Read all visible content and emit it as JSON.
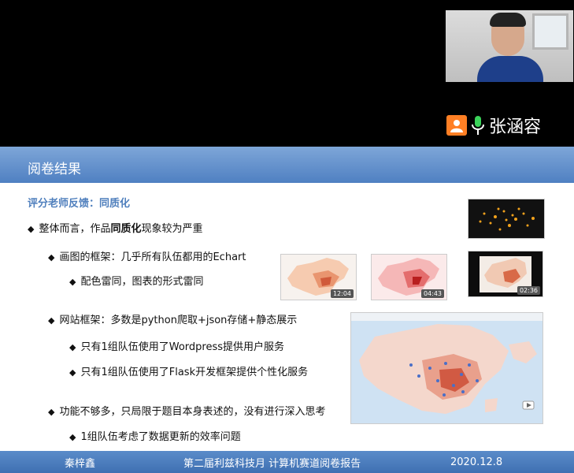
{
  "speaker": {
    "name": "张涵容",
    "avatar_icon": "person-icon",
    "mic_icon": "microphone-icon"
  },
  "slide": {
    "title": "阅卷结果",
    "subtitle": "评分老师反馈：同质化",
    "lines": [
      {
        "pre": "整体而言，作品",
        "bold": "同质化",
        "post": "现象较为严重"
      },
      {
        "text": "画图的框架：几乎所有队伍都用的Echart"
      },
      {
        "text": "配色雷同，图表的形式雷同"
      },
      {
        "text": "网站框架：多数是python爬取+json存储+静态展示"
      },
      {
        "text": "只有1组队伍使用了Wordpress提供用户服务"
      },
      {
        "text": "只有1组队伍使用了Flask开发框架提供个性化服务"
      },
      {
        "text": "功能不够多，只局限于题目本身表述的，没有进行深入思考"
      },
      {
        "text": "1组队伍考虑了数据更新的效率问题"
      }
    ],
    "thumb_times": [
      "12:04",
      "04:43",
      "02:36"
    ],
    "footer": {
      "left": "秦梓鑫",
      "center": "第二届利兹科技月 计算机赛道阅卷报告",
      "right": "2020.12.8"
    }
  },
  "colors": {
    "title_bar": "#5b8acb",
    "subtitle": "#4f7fbd",
    "speaker_accent": "#ff7f24"
  }
}
